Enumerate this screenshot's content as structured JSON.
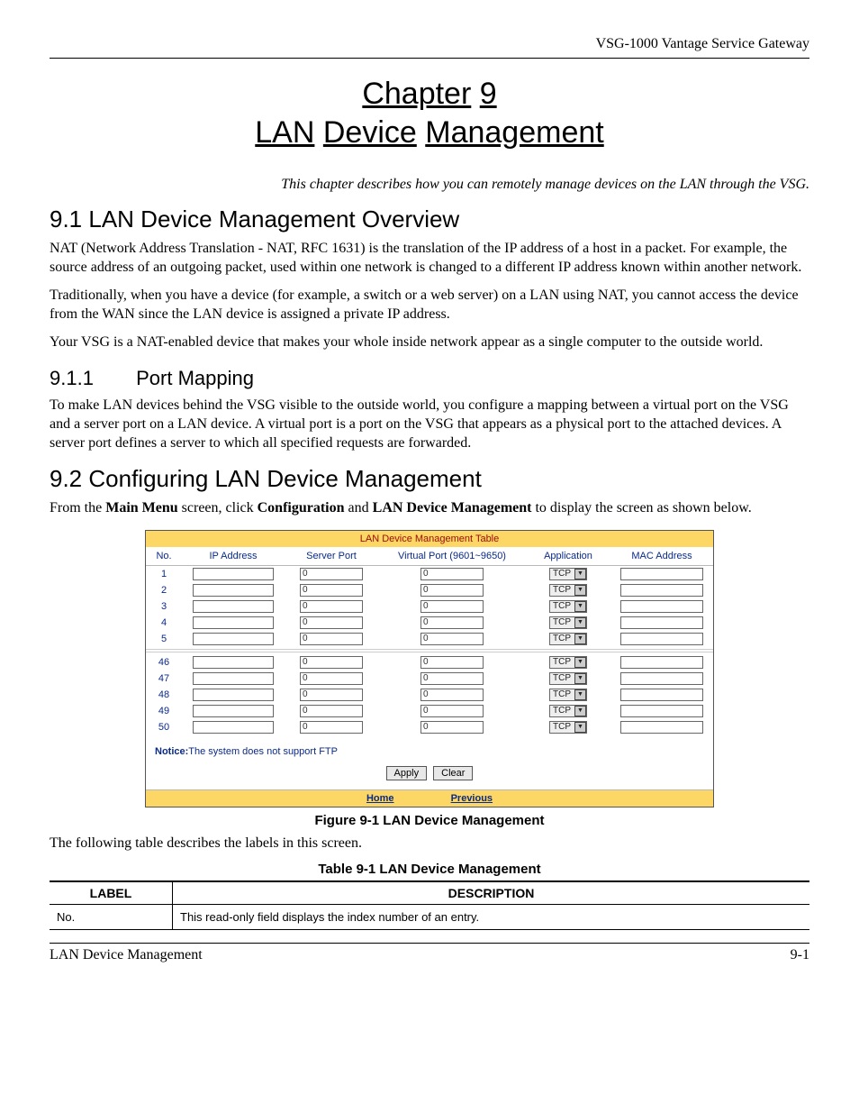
{
  "header": {
    "product": "VSG-1000 Vantage Service Gateway"
  },
  "chapter": {
    "line1_a": "Chapter",
    "line1_b": "9",
    "line2_a": "LAN",
    "line2_b": "Device",
    "line2_c": "Management"
  },
  "lede": "This chapter describes how you can remotely manage devices on the LAN through the VSG.",
  "s91": {
    "heading": "9.1  LAN Device Management Overview",
    "p1": "NAT (Network Address Translation - NAT, RFC 1631) is the translation of the IP address of a host in a packet. For example, the source address of an outgoing packet, used within one network is changed to a different IP address known within another network.",
    "p2": "Traditionally, when you have a device (for example, a switch or a web server) on a LAN using NAT, you cannot access the device from the WAN since the LAN device is assigned a private IP address.",
    "p3": "Your VSG is a NAT-enabled device that makes your whole inside network appear as a single computer to the outside world."
  },
  "s911": {
    "num": "9.1.1",
    "title": "Port Mapping",
    "p1": "To make LAN devices behind the VSG visible to the outside world, you configure a mapping between a virtual port on the VSG and a server port on a LAN device. A virtual port is a port on the VSG that appears as a physical port to the attached devices.  A server port defines a server to which all specified requests are forwarded."
  },
  "s92": {
    "heading": "9.2  Configuring LAN Device Management",
    "p1_a": "From the ",
    "p1_b": "Main Menu",
    "p1_c": " screen, click ",
    "p1_d": "Configuration",
    "p1_e": " and ",
    "p1_f": "LAN Device Management",
    "p1_g": " to display the screen as shown below."
  },
  "screenshot": {
    "title": "LAN Device Management Table",
    "cols": {
      "no": "No.",
      "ip": "IP Address",
      "server": "Server Port",
      "virtual": "Virtual Port (9601~9650)",
      "app": "Application",
      "mac": "MAC Address"
    },
    "rows_top": [
      {
        "no": "1",
        "server": "0",
        "virtual": "0",
        "app": "TCP"
      },
      {
        "no": "2",
        "server": "0",
        "virtual": "0",
        "app": "TCP"
      },
      {
        "no": "3",
        "server": "0",
        "virtual": "0",
        "app": "TCP"
      },
      {
        "no": "4",
        "server": "0",
        "virtual": "0",
        "app": "TCP"
      },
      {
        "no": "5",
        "server": "0",
        "virtual": "0",
        "app": "TCP"
      }
    ],
    "rows_bottom": [
      {
        "no": "46",
        "server": "0",
        "virtual": "0",
        "app": "TCP"
      },
      {
        "no": "47",
        "server": "0",
        "virtual": "0",
        "app": "TCP"
      },
      {
        "no": "48",
        "server": "0",
        "virtual": "0",
        "app": "TCP"
      },
      {
        "no": "49",
        "server": "0",
        "virtual": "0",
        "app": "TCP"
      },
      {
        "no": "50",
        "server": "0",
        "virtual": "0",
        "app": "TCP"
      }
    ],
    "notice_label": "Notice:",
    "notice_text": "The system does not support FTP",
    "buttons": {
      "apply": "Apply",
      "clear": "Clear"
    },
    "nav": {
      "home": "Home",
      "previous": "Previous"
    }
  },
  "figure_caption": "Figure 9-1 LAN Device Management",
  "after_figure": "The following table describes the labels in this screen.",
  "table_caption": "Table 9-1 LAN Device Management",
  "desc_table": {
    "headers": {
      "label": "LABEL",
      "desc": "DESCRIPTION"
    },
    "rows": [
      {
        "label": "No.",
        "desc": "This read-only field displays the index number of an entry."
      }
    ]
  },
  "footer": {
    "left": "LAN Device Management",
    "right": "9-1"
  }
}
